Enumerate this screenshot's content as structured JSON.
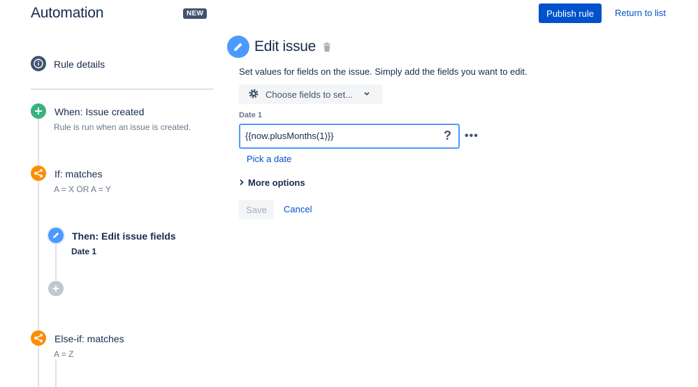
{
  "header": {
    "title": "Automation",
    "badge": "NEW",
    "publish_label": "Publish rule",
    "return_label": "Return to list"
  },
  "sidebar": {
    "rule_details": "Rule details",
    "nodes": [
      {
        "title": "When: Issue created",
        "subtitle": "Rule is run when an issue is created.",
        "icon": "plus-icon",
        "color": "#36B37E"
      },
      {
        "title": "If: matches",
        "subtitle": "A = X OR A = Y",
        "icon": "branch-icon",
        "color": "#FF8B00"
      },
      {
        "title": "Then: Edit issue fields",
        "subtitle": "Date 1",
        "icon": "pencil-icon",
        "color": "#4C9AFF"
      },
      {
        "title": "Else-if: matches",
        "subtitle": "A = Z",
        "icon": "branch-icon",
        "color": "#FF8B00"
      }
    ]
  },
  "editor": {
    "title": "Edit issue",
    "description": "Set values for fields on the issue. Simply add the fields you want to edit.",
    "choose_fields_label": "Choose fields to set...",
    "field_label": "Date 1",
    "field_value": "{{now.plusMonths(1)}}",
    "help_symbol": "?",
    "more_symbol": "•••",
    "pick_date_label": "Pick a date",
    "more_options_label": "More options",
    "save_label": "Save",
    "cancel_label": "Cancel"
  },
  "colors": {
    "primary": "#0052CC",
    "text": "#172B4D",
    "green": "#36B37E",
    "orange": "#FF8B00",
    "blue": "#4C9AFF"
  }
}
